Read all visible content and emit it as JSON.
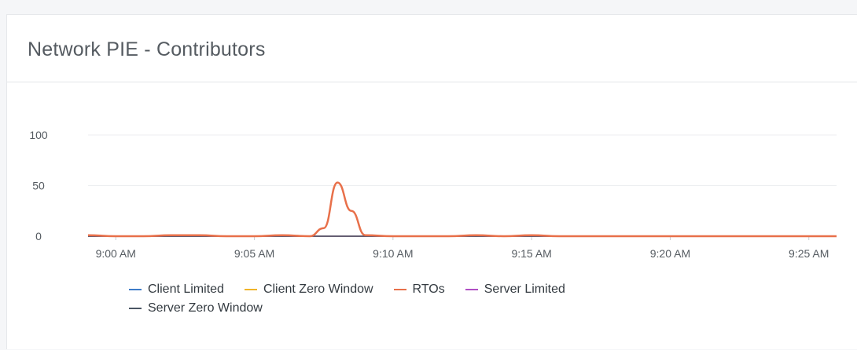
{
  "panel": {
    "title": "Network PIE - Contributors"
  },
  "chart_data": {
    "type": "line",
    "title": "",
    "xlabel": "",
    "ylabel": "",
    "ylim": [
      0,
      100
    ],
    "yticks": [
      "0",
      "50",
      "100"
    ],
    "xlim": [
      "8:59 AM",
      "9:26 AM"
    ],
    "xticks": [
      "9:00 AM",
      "9:05 AM",
      "9:10 AM",
      "9:15 AM",
      "9:20 AM",
      "9:25 AM"
    ],
    "grid": true,
    "legend_position": "bottom",
    "series": [
      {
        "name": "Client Limited",
        "color": "#3d7cc9",
        "points": [
          [
            "8:59",
            0
          ],
          [
            "9:26",
            0
          ]
        ]
      },
      {
        "name": "Client Zero Window",
        "color": "#f0b429",
        "points": [
          [
            "8:59",
            0
          ],
          [
            "9:26",
            0
          ]
        ]
      },
      {
        "name": "RTOs",
        "color": "#e8704a",
        "points": [
          [
            "8:59",
            1
          ],
          [
            "9:00",
            0
          ],
          [
            "9:01",
            0
          ],
          [
            "9:02",
            1
          ],
          [
            "9:03",
            1
          ],
          [
            "9:04",
            0
          ],
          [
            "9:05",
            0
          ],
          [
            "9:06",
            1
          ],
          [
            "9:07",
            0
          ],
          [
            "9:07:30",
            8
          ],
          [
            "9:08",
            53
          ],
          [
            "9:08:30",
            25
          ],
          [
            "9:09",
            1
          ],
          [
            "9:10",
            0
          ],
          [
            "9:11",
            0
          ],
          [
            "9:12",
            0
          ],
          [
            "9:13",
            1
          ],
          [
            "9:14",
            0
          ],
          [
            "9:15",
            1
          ],
          [
            "9:16",
            0
          ],
          [
            "9:20",
            0
          ],
          [
            "9:25",
            0
          ],
          [
            "9:26",
            0
          ]
        ]
      },
      {
        "name": "Server Limited",
        "color": "#b04fc4",
        "points": [
          [
            "8:59",
            0
          ],
          [
            "9:26",
            0
          ]
        ]
      },
      {
        "name": "Server Zero Window",
        "color": "#4a5563",
        "points": [
          [
            "8:59",
            0
          ],
          [
            "9:26",
            0
          ]
        ]
      }
    ]
  }
}
